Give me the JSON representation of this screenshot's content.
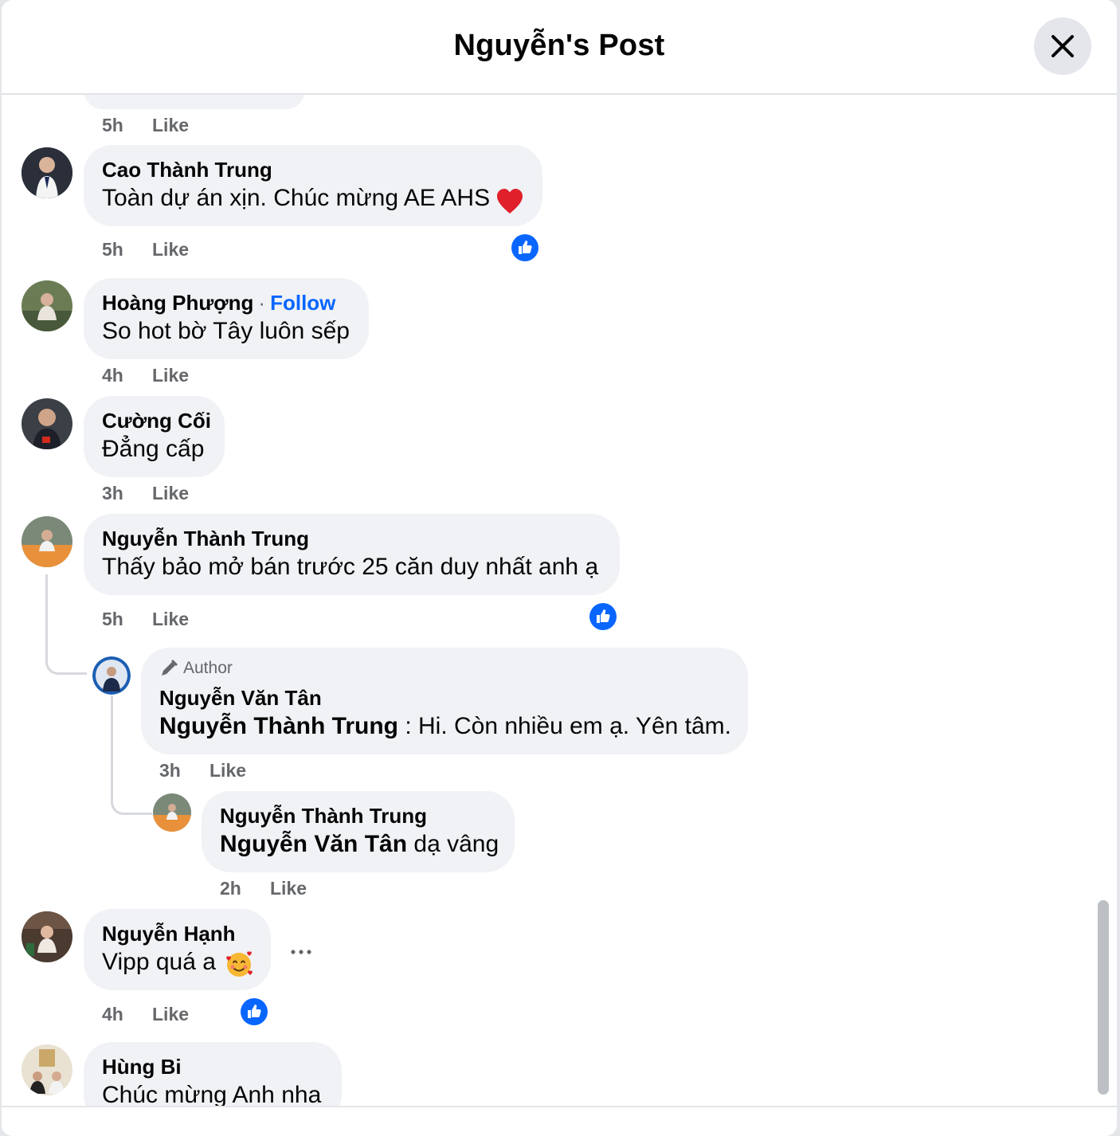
{
  "header": {
    "title": "Nguyễn's Post"
  },
  "actions": {
    "like_label": "Like",
    "follow_label": "Follow",
    "author_label": "Author"
  },
  "colors": {
    "like_blue": "#0866ff",
    "bubble_bg": "#f0f2f5",
    "meta_gray": "#65676b"
  },
  "comments": [
    {
      "time": "5h"
    },
    {
      "name": "Cao Thành Trung",
      "text": "Toàn dự án xịn. Chúc mừng AE AHS",
      "emoji": "red-heart",
      "time": "5h",
      "reactions": "like"
    },
    {
      "name": "Hoàng Phượng",
      "text": "So hot bờ Tây luôn sếp",
      "time": "4h"
    },
    {
      "name": "Cường Cối",
      "text": "Đẳng cấp",
      "time": "3h"
    },
    {
      "name": "Nguyễn Thành Trung",
      "text": "Thấy bảo mở bán trước 25 căn duy nhất anh ạ",
      "time": "5h",
      "reactions": "like",
      "replies": [
        {
          "name": "Nguyễn Văn Tân",
          "mention": "Nguyễn Thành Trung",
          "text": " : Hi. Còn nhiều em ạ. Yên tâm.",
          "time": "3h"
        },
        {
          "name": "Nguyễn Thành Trung",
          "mention": "Nguyễn Văn Tân",
          "text": " dạ vâng",
          "time": "2h"
        }
      ]
    },
    {
      "name": "Nguyễn Hạnh",
      "text": "Vipp quá a",
      "emoji": "smiling-face-with-hearts",
      "time": "4h",
      "reactions": "like"
    },
    {
      "name": "Hùng Bi",
      "text": "Chúc mừng Anh nha"
    }
  ]
}
